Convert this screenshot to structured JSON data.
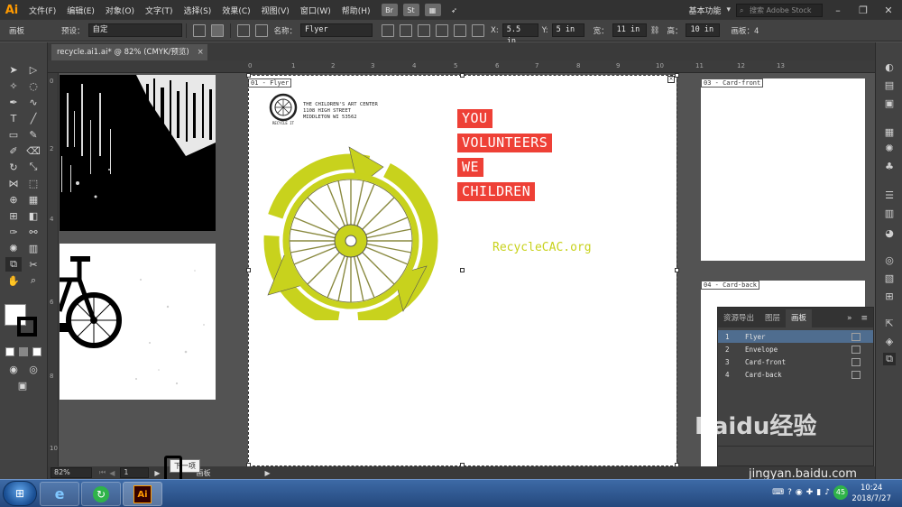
{
  "menubar": {
    "logo": "Ai",
    "items": [
      "文件(F)",
      "编辑(E)",
      "对象(O)",
      "文字(T)",
      "选择(S)",
      "效果(C)",
      "视图(V)",
      "窗口(W)",
      "帮助(H)"
    ],
    "bridge": "Br",
    "stock": "St",
    "workspace": "基本功能",
    "stock_search_placeholder": "搜索 Adobe Stock"
  },
  "controlbar": {
    "panel_label": "画板",
    "preset_label": "预设：",
    "preset_value": "自定",
    "name_label": "名称：",
    "name_value": "Flyer",
    "x_label": "X:",
    "x_value": "5.5 in",
    "y_label": "Y:",
    "y_value": "5 in",
    "w_label": "宽：",
    "w_value": "11 in",
    "h_label": "高：",
    "h_value": "10 in",
    "artboard_count": "画板：4"
  },
  "tab": {
    "title": "recycle.ai1.ai* @ 82% (CMYK/预览)",
    "close": "×"
  },
  "ruler_top": [
    "0",
    "1",
    "2",
    "3",
    "4",
    "5",
    "6",
    "7",
    "8",
    "9",
    "10",
    "11",
    "12",
    "13"
  ],
  "ruler_left": [
    "0",
    "2",
    "4",
    "6",
    "8",
    "10"
  ],
  "artboards": {
    "flyer_label": "01 - Flyer",
    "card_front_label": "03 - Card-front",
    "card_back_label": "04 - Card-back"
  },
  "flyer": {
    "org_line1": "THE CHILDREN'S ART CENTER",
    "org_line2": "1108 HIGH STREET",
    "org_line3": "MIDDLETON WI 53562",
    "logo_text": "RECYCLE IT",
    "words": [
      "YOU",
      "VOLUNTEERS",
      "WE",
      "CHILDREN"
    ],
    "site": "RecycleCAC.org"
  },
  "panel": {
    "tabs": [
      "资源导出",
      "图层",
      "画板"
    ],
    "rows": [
      {
        "num": "1",
        "name": "Flyer"
      },
      {
        "num": "2",
        "name": "Envelope"
      },
      {
        "num": "3",
        "name": "Card-front"
      },
      {
        "num": "4",
        "name": "Card-back"
      }
    ]
  },
  "status": {
    "zoom": "82%",
    "page": "1",
    "tool": "画板",
    "tooltip": "下一项"
  },
  "taskbar": {
    "clock_time": "10:24",
    "clock_date": "2018/7/27",
    "tray_badge": "45",
    "app_label": "Ai"
  },
  "watermark": {
    "brand": "Baidu经验",
    "url": "jingyan.baidu.com"
  },
  "colors": {
    "accent_red": "#ee4036",
    "accent_yellow": "#c8d21d",
    "ai_orange": "#ff9a00"
  }
}
